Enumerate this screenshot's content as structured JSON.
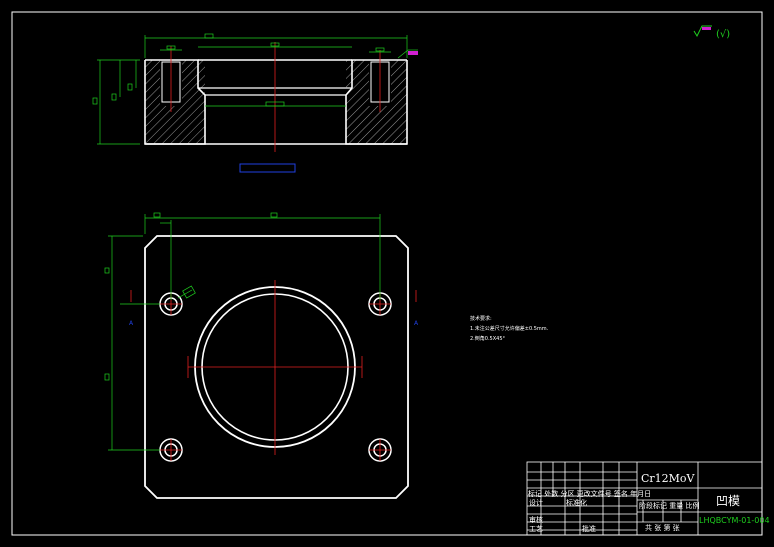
{
  "drawing": {
    "roughness_symbol": "(√)",
    "notes": {
      "title": "技术要求:",
      "line1": "1.未注公差尺寸允许偏差±0.5mm.",
      "line2": "2.倒角0.5X45°"
    },
    "section_labels": {
      "left": "A",
      "right": "A"
    },
    "title_block": {
      "material": "Cr12MoV",
      "part_name": "凹模",
      "drawing_no": "LHQBCYM-01-004",
      "row_labels": "标记 处数 分区 更改文件号 签名 年月日",
      "design": "设计",
      "standardize": "标准化",
      "review": "审核",
      "process": "工艺",
      "approve": "批准",
      "stage_labels": "阶段标记 重量 比例",
      "sheets": "共  张  第  张"
    }
  }
}
